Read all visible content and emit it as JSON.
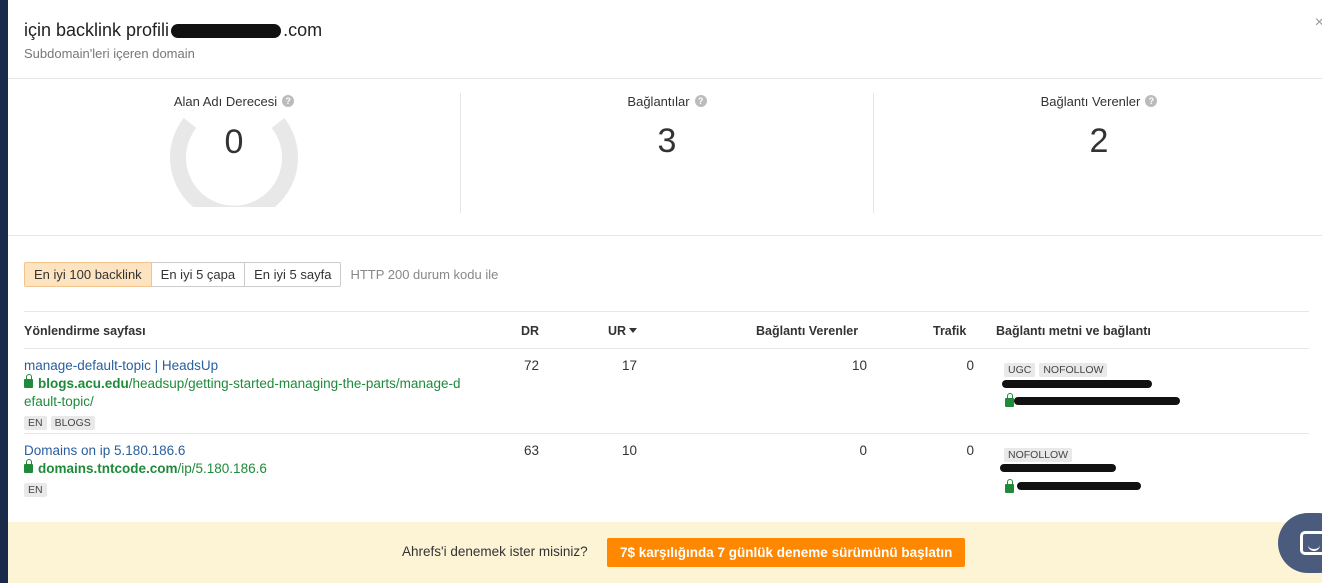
{
  "header": {
    "title_prefix": "için backlink profili",
    "title_suffix": ".com",
    "subtitle": "Subdomain'leri içeren domain",
    "close": "×"
  },
  "stats": {
    "domain_rating": {
      "label": "Alan Adı Derecesi",
      "value": "0",
      "gauge_fraction": 0
    },
    "backlinks": {
      "label": "Bağlantılar",
      "value": "3"
    },
    "referring_domains": {
      "label": "Bağlantı Verenler",
      "value": "2"
    }
  },
  "tabs": [
    {
      "label": "En iyi 100 backlink",
      "active": true
    },
    {
      "label": "En iyi 5 çapa",
      "active": false
    },
    {
      "label": "En iyi 5 sayfa",
      "active": false
    }
  ],
  "http_note": "HTTP 200 durum kodu ile",
  "table": {
    "headers": {
      "page": "Yönlendirme sayfası",
      "dr": "DR",
      "ur": "UR",
      "ref_domains": "Bağlantı Verenler",
      "traffic": "Trafik",
      "anchor": "Bağlantı metni ve bağlantı"
    },
    "rows": [
      {
        "title": "manage-default-topic | HeadsUp",
        "url_domain": "blogs.acu.edu",
        "url_path": "/headsup/getting-started-managing-the-parts/manage-default-topic/",
        "tags": [
          "EN",
          "BLOGS"
        ],
        "dr": "72",
        "ur": "17",
        "ref_domains": "10",
        "traffic": "0",
        "link_tags": [
          "UGC",
          "NOFOLLOW"
        ]
      },
      {
        "title": "Domains on ip 5.180.186.6",
        "url_domain": "domains.tntcode.com",
        "url_path": "/ip/5.180.186.6",
        "tags": [
          "EN"
        ],
        "dr": "63",
        "ur": "10",
        "ref_domains": "0",
        "traffic": "0",
        "link_tags": [
          "NOFOLLOW"
        ]
      }
    ]
  },
  "banner": {
    "text": "Ahrefs'i denemek ister misiniz?",
    "cta": "7$ karşılığında 7 günlük deneme sürümünü başlatın"
  },
  "colors": {
    "accent": "#ff8800",
    "active_tab": "#fde3c0",
    "link_title": "#2a5f9e",
    "link_url": "#1f8a3a",
    "banner_bg": "#fdf3d5"
  }
}
